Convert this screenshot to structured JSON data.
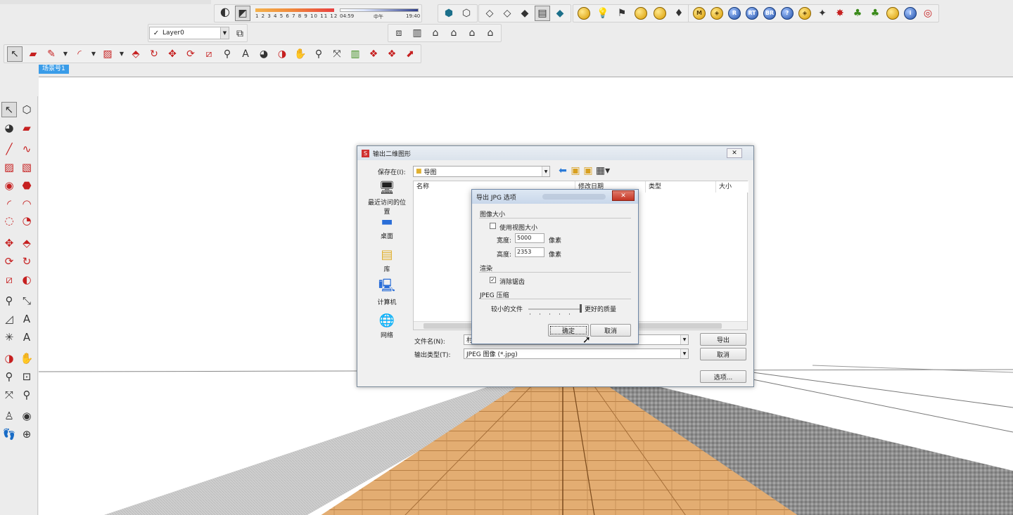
{
  "layer": {
    "name": "Layer0"
  },
  "scene_tab": "场景号1",
  "shadow": {
    "months": "1 2 3 4 5 6 7 8 9 10 11 12",
    "time_start": "04:59",
    "time_mid": "中午",
    "time_end": "19:40"
  },
  "export_dialog": {
    "title": "输出二维图形",
    "save_in_label": "保存在(I):",
    "save_in_value": "导图",
    "places": [
      "最近访问的位置",
      "桌面",
      "库",
      "计算机",
      "网络"
    ],
    "columns": [
      "名称",
      "修改日期",
      "类型",
      "大小"
    ],
    "filename_label": "文件名(N):",
    "filename_value": "村",
    "filetype_label": "输出类型(T):",
    "filetype_value": "JPEG 图像 (*.jpg)",
    "export_button": "导出",
    "cancel_button": "取消",
    "options_button": "选项..."
  },
  "jpg_dialog": {
    "title": "导出 JPG 选项",
    "image_size_group": "图像大小",
    "use_view_size_label": "使用视图大小",
    "use_view_size_checked": false,
    "width_label": "宽度:",
    "width_value": "5000",
    "height_label": "高度:",
    "height_value": "2353",
    "unit": "像素",
    "render_group": "渲染",
    "antialias_label": "消除锯齿",
    "antialias_checked": true,
    "jpeg_group": "JPEG 压缩",
    "small_file_label": "较小的文件",
    "better_quality_label": "更好的质量",
    "quality": 1.0,
    "ok_button": "确定",
    "cancel_button": "取消"
  },
  "colors": {
    "scene_tab": "#3a9ce8",
    "floor_wood": "#e0aa6f",
    "floor_gray": "#9a9a9a",
    "floor_left": "#c8c8c8"
  }
}
